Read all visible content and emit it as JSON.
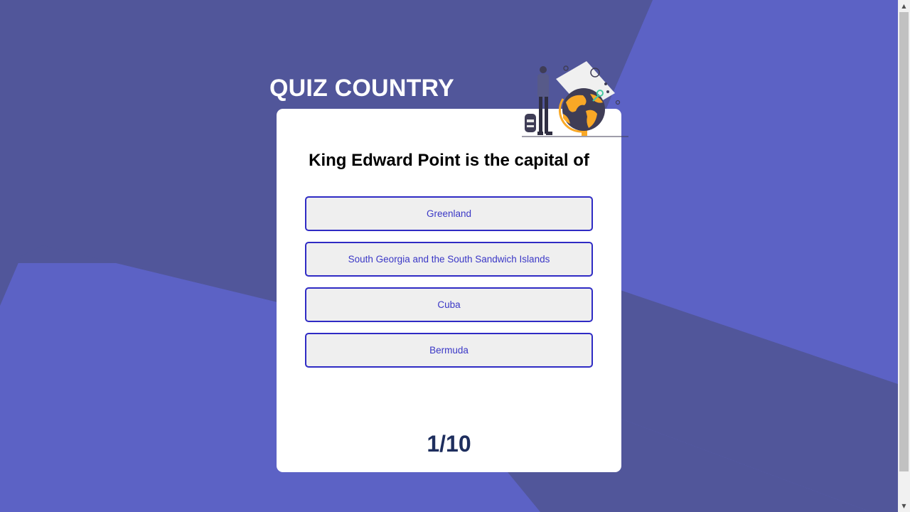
{
  "app": {
    "title": "QUIZ COUNTRY"
  },
  "quiz": {
    "question": "King Edward Point is the capital of",
    "answers": [
      {
        "label": "Greenland"
      },
      {
        "label": "South Georgia and the South Sandwich Islands"
      },
      {
        "label": "Cuba"
      },
      {
        "label": "Bermuda"
      }
    ],
    "progress": "1/10"
  },
  "scrollbar": {
    "up_arrow": "▲",
    "down_arrow": "▼"
  },
  "colors": {
    "background_light": "#5c62c5",
    "background_dark": "#51569a",
    "card": "#ffffff",
    "answer_border": "#2f2bc4",
    "answer_text": "#3a37c6",
    "answer_fill": "#efefef",
    "progress_text": "#1e2e5e"
  },
  "icons": {
    "illustration": "traveler-globe-illustration"
  }
}
